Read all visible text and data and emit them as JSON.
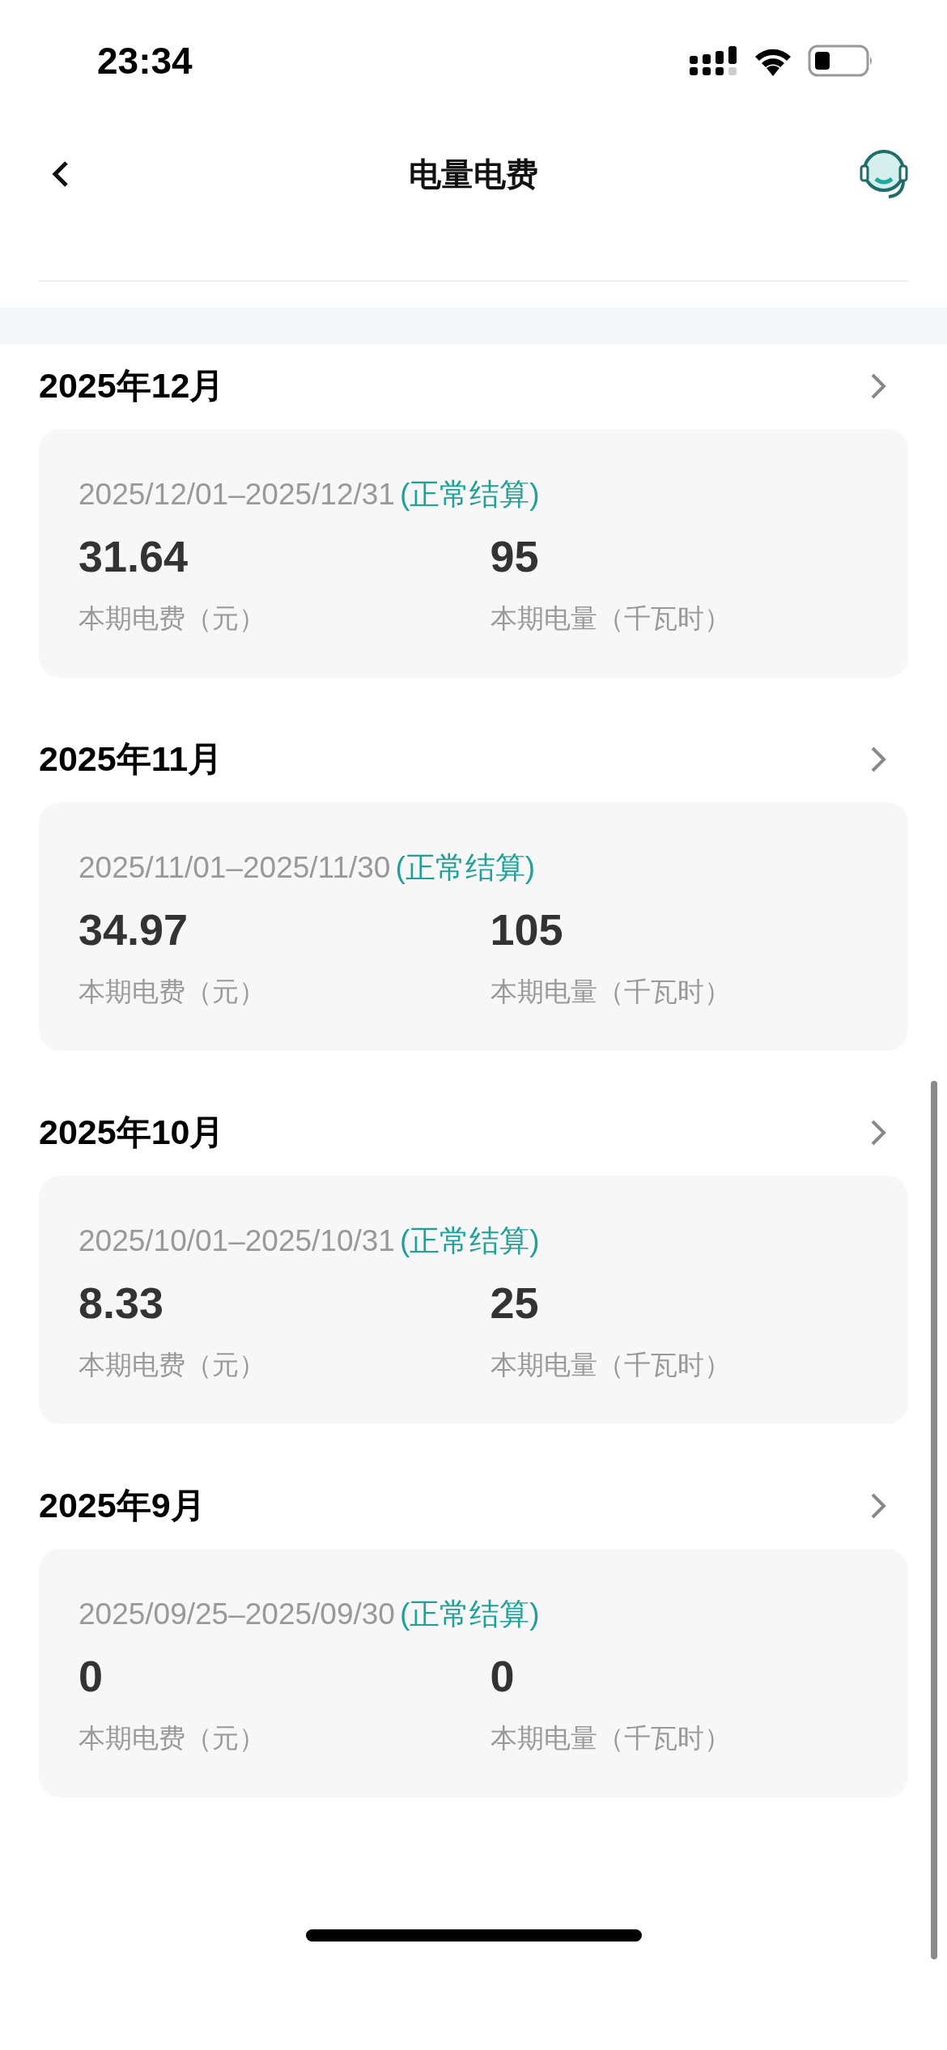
{
  "status_bar": {
    "time": "23:34"
  },
  "header": {
    "title": "电量电费"
  },
  "periods": [
    {
      "month": "2025年12月",
      "range": "2025/12/01–2025/12/31",
      "status": "(正常结算)",
      "fee": "31.64",
      "fee_label": "本期电费（元）",
      "usage": "95",
      "usage_label": "本期电量（千瓦时）"
    },
    {
      "month": "2025年11月",
      "range": "2025/11/01–2025/11/30",
      "status": "(正常结算)",
      "fee": "34.97",
      "fee_label": "本期电费（元）",
      "usage": "105",
      "usage_label": "本期电量（千瓦时）"
    },
    {
      "month": "2025年10月",
      "range": "2025/10/01–2025/10/31",
      "status": "(正常结算)",
      "fee": "8.33",
      "fee_label": "本期电费（元）",
      "usage": "25",
      "usage_label": "本期电量（千瓦时）"
    },
    {
      "month": "2025年9月",
      "range": "2025/09/25–2025/09/30",
      "status": "(正常结算)",
      "fee": "0",
      "fee_label": "本期电费（元）",
      "usage": "0",
      "usage_label": "本期电量（千瓦时）"
    }
  ]
}
